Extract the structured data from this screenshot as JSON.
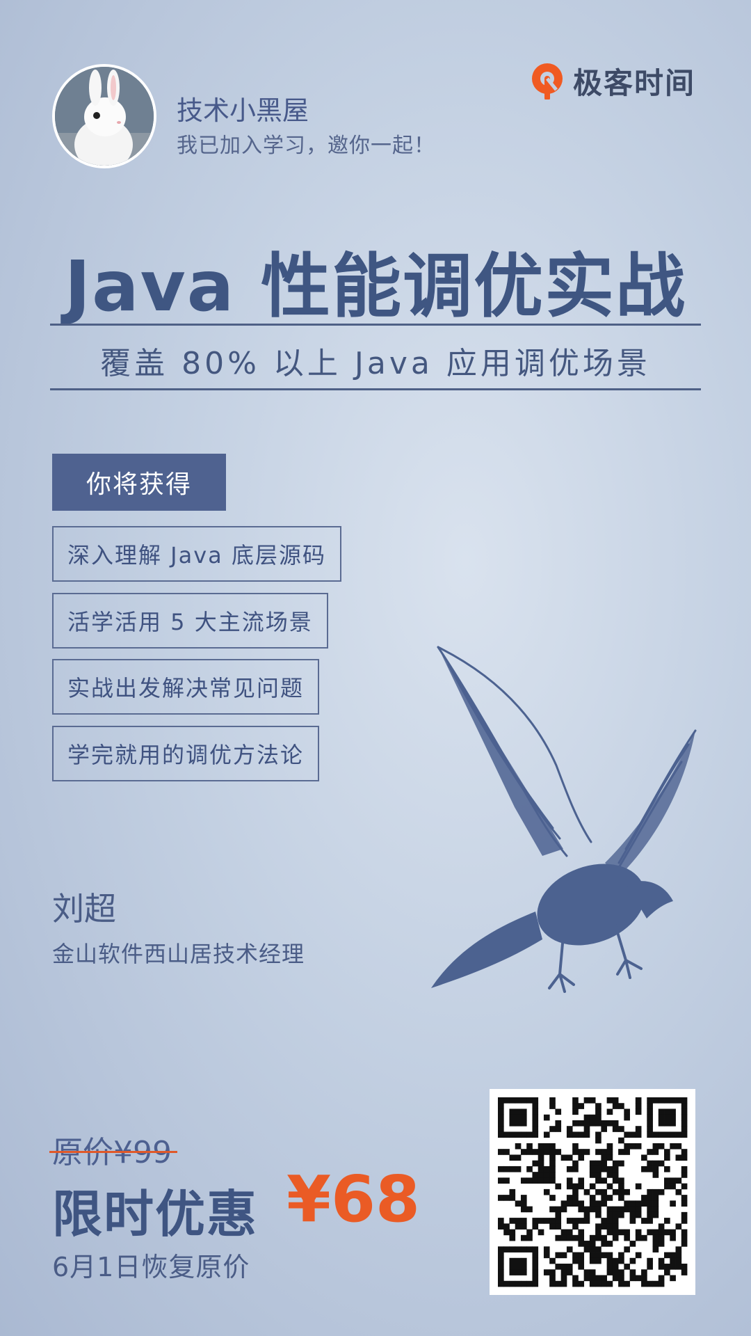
{
  "header": {
    "user_name": "技术小黑屋",
    "user_note": "我已加入学习，邀你一起！",
    "logo_text": "极客时间",
    "logo_color": "#f05a22"
  },
  "course": {
    "title": "Java 性能调优实战",
    "subtitle": "覆盖 80% 以上 Java 应用调优场景"
  },
  "benefits": {
    "heading": "你将获得",
    "items": [
      "深入理解 Java 底层源码",
      "活学活用 5 大主流场景",
      "实战出发解决常见问题",
      "学完就用的调优方法论"
    ]
  },
  "author": {
    "name": "刘超",
    "title": "金山软件西山居技术经理"
  },
  "pricing": {
    "original": "原价¥99",
    "promo_label": "限时优惠",
    "promo_price": "¥68",
    "restore_note": "6月1日恢复原价",
    "accent_color": "#ea5b25"
  },
  "icons": [
    "avatar-rabbit",
    "geek-time-logo-icon",
    "eagle-illustration",
    "qr-code"
  ]
}
